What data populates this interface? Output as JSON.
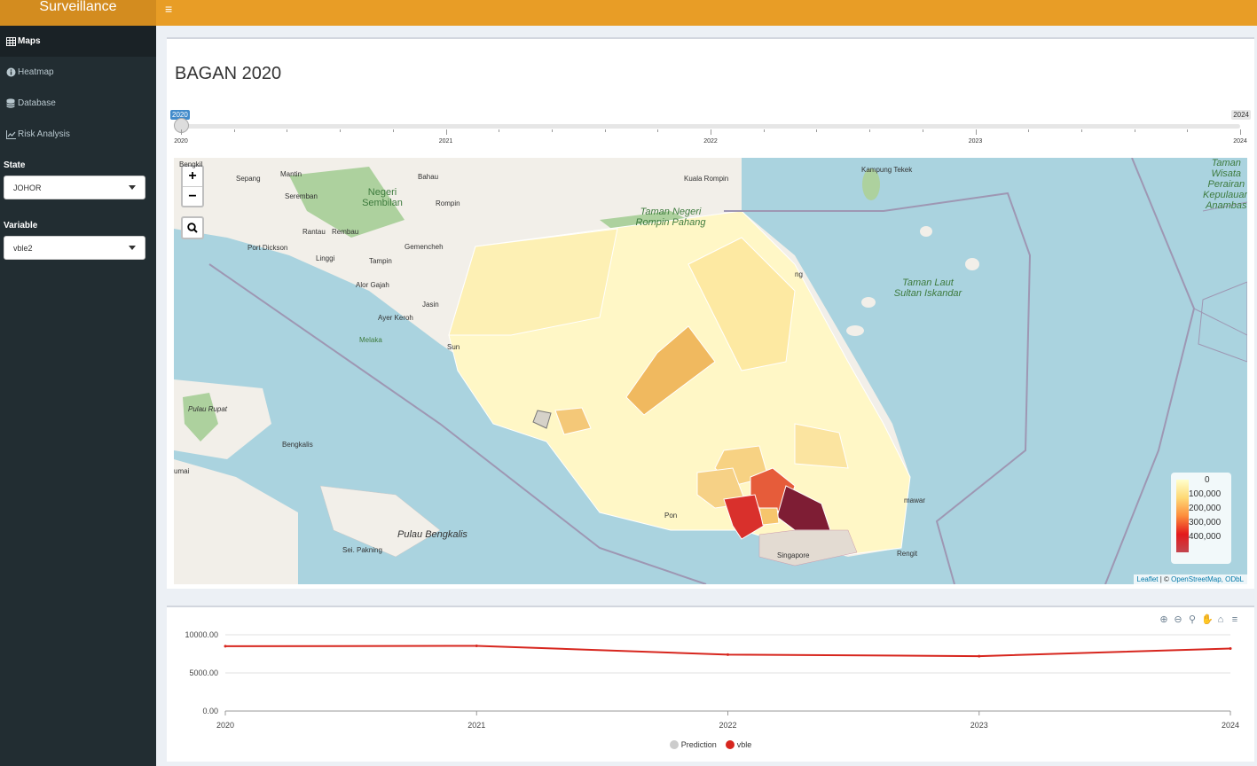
{
  "header": {
    "brand": "Surveillance",
    "menu_icon": "hamburger-icon"
  },
  "sidebar": {
    "items": [
      {
        "label": "Maps",
        "icon": "table-icon",
        "active": true
      },
      {
        "label": "Heatmap",
        "icon": "info-icon",
        "active": false
      },
      {
        "label": "Database",
        "icon": "database-icon",
        "active": false
      },
      {
        "label": "Risk Analysis",
        "icon": "line-chart-icon",
        "active": false
      }
    ],
    "state_label": "State",
    "state_value": "JOHOR",
    "variable_label": "Variable",
    "variable_value": "vble2"
  },
  "main": {
    "title": "BAGAN 2020",
    "slider": {
      "min": 2020,
      "max": 2024,
      "value": 2020,
      "value_label": "2020",
      "max_label": "2024",
      "tick_labels": [
        "2020",
        "2021",
        "2022",
        "2023",
        "2024"
      ]
    },
    "map": {
      "zoom_in": "+",
      "zoom_out": "−",
      "place_labels": [
        "Bengkil",
        "Sepang",
        "Mantin",
        "Bahau",
        "Kuala Rompin",
        "Kampung Tekek",
        "Seremban",
        "Negeri Sembilan",
        "Rompin",
        "Taman Negeri Rompin Pahang",
        "Rantau",
        "Rembau",
        "Port Dickson",
        "Gemencheh",
        "Linggi",
        "Tampin",
        "Alor Gajah",
        "Jasin",
        "Ayer Keroh",
        "Melaka",
        "Sun",
        "Taman Laut Sultan Iskandar",
        "Taman Wisata Perairan Kepulauan Anambas",
        "Pulau Rupat",
        "Bengkalis",
        "Pulau Bengkalis",
        "Sei. Pakning",
        "Singapore",
        "Rengit",
        "Pon",
        "mawar",
        "umai",
        "ng"
      ],
      "legend": {
        "values": [
          "0",
          "100,000",
          "200,000",
          "300,000",
          "400,000"
        ],
        "colors": [
          "#ffffcc",
          "#fed976",
          "#fd8d3c",
          "#e31a1c",
          "#c3454e"
        ]
      },
      "attribution_leaflet": "Leaflet",
      "attribution_sep": " | © ",
      "attribution_osm": "OpenStreetMap, ODbL"
    },
    "chart_data": {
      "type": "line",
      "x": [
        2020,
        2021,
        2022,
        2023,
        2024
      ],
      "series": [
        {
          "name": "Prediction",
          "values": [],
          "color": "#cccccc"
        },
        {
          "name": "vble",
          "values": [
            8500,
            8550,
            7400,
            7200,
            8200
          ],
          "color": "#d7261e"
        }
      ],
      "ylim": [
        0,
        10000
      ],
      "yticks": [
        "10000.00",
        "5000.00",
        "0.00"
      ],
      "xticks": [
        "2020",
        "2021",
        "2022",
        "2023",
        "2024"
      ],
      "legend": [
        "Prediction",
        "vble"
      ],
      "grid": true
    }
  }
}
